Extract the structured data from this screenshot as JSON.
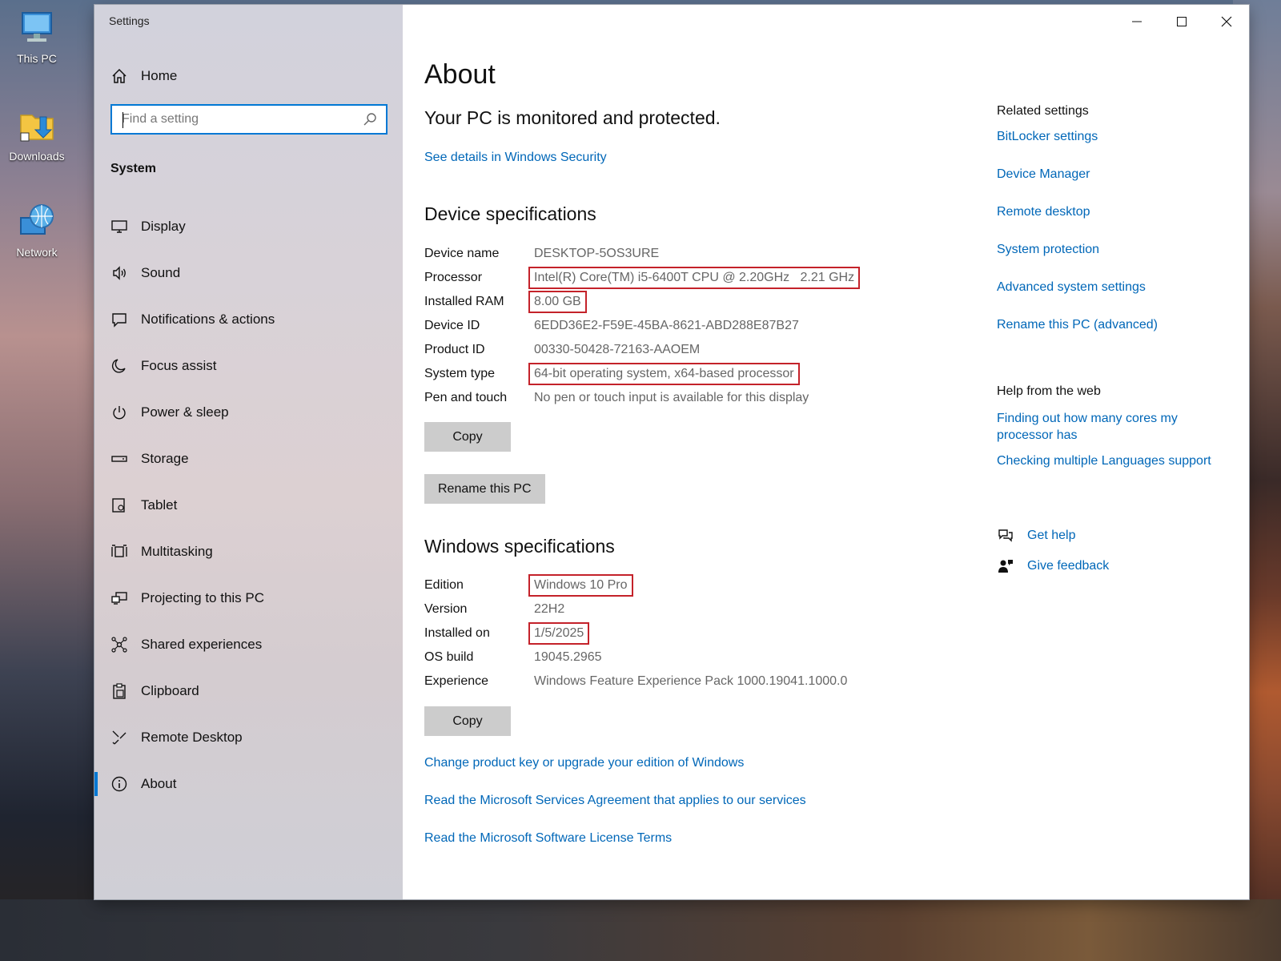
{
  "desktop": {
    "icons": [
      {
        "label": "This PC"
      },
      {
        "label": "Downloads"
      },
      {
        "label": "Network"
      }
    ]
  },
  "window": {
    "title": "Settings",
    "accent_color": "#0078d4",
    "link_color": "#0067b8",
    "highlight_color": "#c4222a"
  },
  "sidebar": {
    "home_label": "Home",
    "search_placeholder": "Find a setting",
    "search_value": "",
    "section_label": "System",
    "items": [
      {
        "label": "Display",
        "icon": "monitor-icon"
      },
      {
        "label": "Sound",
        "icon": "speaker-icon"
      },
      {
        "label": "Notifications & actions",
        "icon": "message-icon"
      },
      {
        "label": "Focus assist",
        "icon": "moon-icon"
      },
      {
        "label": "Power & sleep",
        "icon": "power-icon"
      },
      {
        "label": "Storage",
        "icon": "drive-icon"
      },
      {
        "label": "Tablet",
        "icon": "tablet-icon"
      },
      {
        "label": "Multitasking",
        "icon": "multitasking-icon"
      },
      {
        "label": "Projecting to this PC",
        "icon": "projecting-icon"
      },
      {
        "label": "Shared experiences",
        "icon": "shared-icon"
      },
      {
        "label": "Clipboard",
        "icon": "clipboard-icon"
      },
      {
        "label": "Remote Desktop",
        "icon": "remote-desktop-icon"
      },
      {
        "label": "About",
        "icon": "info-icon",
        "active": true
      }
    ]
  },
  "main": {
    "title": "About",
    "protection_message": "Your PC is monitored and protected.",
    "security_link": "See details in Windows Security",
    "device_specs": {
      "heading": "Device specifications",
      "rows": [
        {
          "key": "Device name",
          "value": "DESKTOP-5OS3URE",
          "highlighted": false
        },
        {
          "key": "Processor",
          "value": "Intel(R) Core(TM) i5-6400T CPU @ 2.20GHz   2.21 GHz",
          "highlighted": true
        },
        {
          "key": "Installed RAM",
          "value": "8.00 GB",
          "highlighted": true
        },
        {
          "key": "Device ID",
          "value": "6EDD36E2-F59E-45BA-8621-ABD288E87B27",
          "highlighted": false
        },
        {
          "key": "Product ID",
          "value": "00330-50428-72163-AAOEM",
          "highlighted": false
        },
        {
          "key": "System type",
          "value": "64-bit operating system, x64-based processor",
          "highlighted": true
        },
        {
          "key": "Pen and touch",
          "value": "No pen or touch input is available for this display",
          "highlighted": false
        }
      ],
      "copy_label": "Copy",
      "rename_label": "Rename this PC"
    },
    "windows_specs": {
      "heading": "Windows specifications",
      "rows": [
        {
          "key": "Edition",
          "value": "Windows 10 Pro",
          "highlighted": true
        },
        {
          "key": "Version",
          "value": "22H2",
          "highlighted": false
        },
        {
          "key": "Installed on",
          "value": "1/5/2025",
          "highlighted": true
        },
        {
          "key": "OS build",
          "value": "19045.2965",
          "highlighted": false
        },
        {
          "key": "Experience",
          "value": "Windows Feature Experience Pack 1000.19041.1000.0",
          "highlighted": false
        }
      ],
      "copy_label": "Copy"
    },
    "bottom_links": [
      "Change product key or upgrade your edition of Windows",
      "Read the Microsoft Services Agreement that applies to our services",
      "Read the Microsoft Software License Terms"
    ]
  },
  "related_settings": {
    "heading": "Related settings",
    "links": [
      "BitLocker settings",
      "Device Manager",
      "Remote desktop",
      "System protection",
      "Advanced system settings",
      "Rename this PC (advanced)"
    ]
  },
  "help_from_web": {
    "heading": "Help from the web",
    "links": [
      "Finding out how many cores my processor has",
      "Checking multiple Languages support"
    ]
  },
  "support": {
    "get_help": "Get help",
    "give_feedback": "Give feedback"
  }
}
